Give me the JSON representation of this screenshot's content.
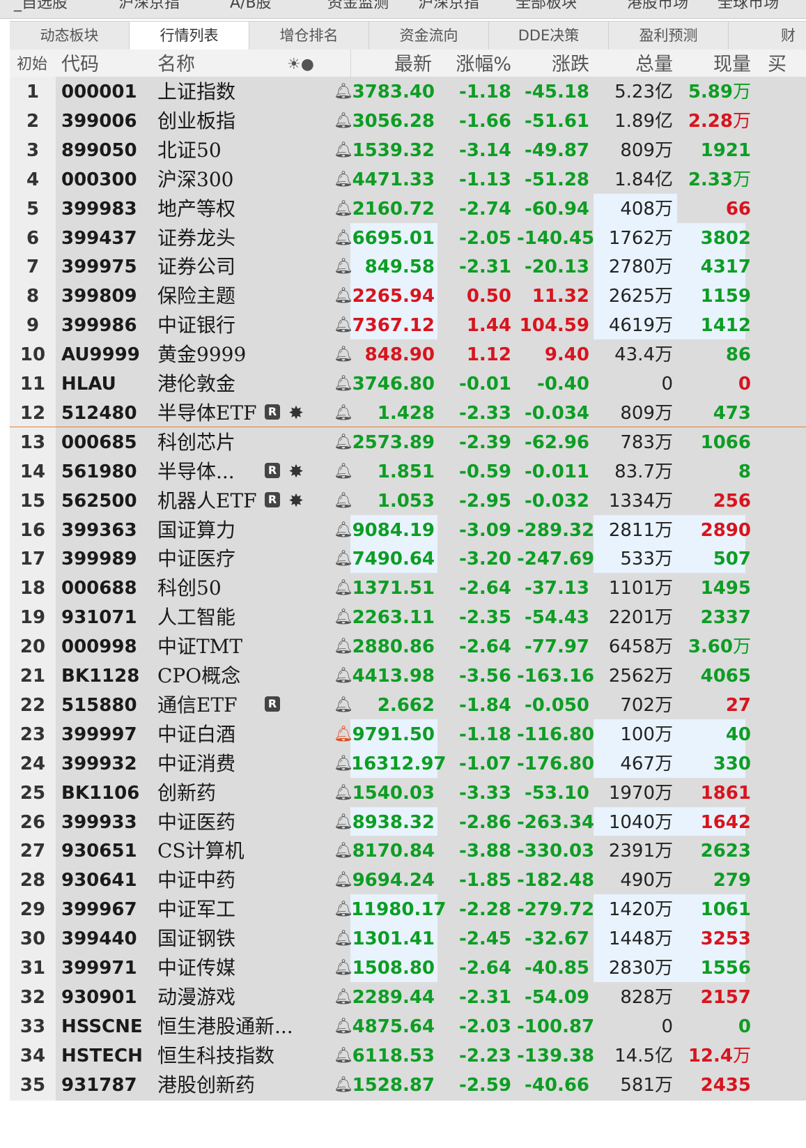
{
  "top_strip": [
    "_自选股",
    "沪深京指",
    "A/B股",
    "资金监测",
    "沪深京指",
    "全部板块",
    "港股市场",
    "全球市场"
  ],
  "tabs": [
    "动态板块",
    "行情列表",
    "增仓排名",
    "资金流向",
    "DDE决策",
    "盈利预测",
    "财"
  ],
  "active_tab": 1,
  "header": {
    "init": "初始",
    "code": "代码",
    "name": "名称",
    "icons": "☀●",
    "last": "最新",
    "pct": "涨幅%",
    "chg": "涨跌",
    "vol": "总量",
    "cur": "现量",
    "more": "买"
  },
  "colors": {
    "up": "#d8141e",
    "down": "#0d9d24",
    "highlight": "#e8f3fe",
    "separator": "#e2803a"
  },
  "rows": [
    {
      "idx": "1",
      "code": "000001",
      "name": "上证指数",
      "r": false,
      "sun": false,
      "bell_red": false,
      "last": "3783.40",
      "pct": "-1.18",
      "chg": "-45.18",
      "vol": "5.23",
      "vol_unit": "亿",
      "cur": "5.89",
      "cur_unit": "万",
      "dir": "down",
      "cur_dir": "down",
      "hl_last": false,
      "hl_right": false
    },
    {
      "idx": "2",
      "code": "399006",
      "name": "创业板指",
      "r": false,
      "sun": false,
      "bell_red": false,
      "last": "3056.28",
      "pct": "-1.66",
      "chg": "-51.61",
      "vol": "1.89",
      "vol_unit": "亿",
      "cur": "2.28",
      "cur_unit": "万",
      "dir": "down",
      "cur_dir": "up",
      "hl_last": false,
      "hl_right": false
    },
    {
      "idx": "3",
      "code": "899050",
      "name": "北证50",
      "r": false,
      "sun": false,
      "bell_red": false,
      "last": "1539.32",
      "pct": "-3.14",
      "chg": "-49.87",
      "vol": "809",
      "vol_unit": "万",
      "cur": "1921",
      "cur_unit": "",
      "dir": "down",
      "cur_dir": "down",
      "hl_last": false,
      "hl_right": false
    },
    {
      "idx": "4",
      "code": "000300",
      "name": "沪深300",
      "r": false,
      "sun": false,
      "bell_red": false,
      "last": "4471.33",
      "pct": "-1.13",
      "chg": "-51.28",
      "vol": "1.84",
      "vol_unit": "亿",
      "cur": "2.33",
      "cur_unit": "万",
      "dir": "down",
      "cur_dir": "down",
      "hl_last": false,
      "hl_right": false
    },
    {
      "idx": "5",
      "code": "399983",
      "name": "地产等权",
      "r": false,
      "sun": false,
      "bell_red": false,
      "last": "2160.72",
      "pct": "-2.74",
      "chg": "-60.94",
      "vol": "408",
      "vol_unit": "万",
      "cur": "66",
      "cur_unit": "",
      "dir": "down",
      "cur_dir": "up",
      "hl_last": false,
      "hl_right": "vol"
    },
    {
      "idx": "6",
      "code": "399437",
      "name": "证券龙头",
      "r": false,
      "sun": false,
      "bell_red": false,
      "last": "6695.01",
      "pct": "-2.05",
      "chg": "-140.45",
      "vol": "1762",
      "vol_unit": "万",
      "cur": "3802",
      "cur_unit": "",
      "dir": "down",
      "cur_dir": "down",
      "hl_last": true,
      "hl_right": true
    },
    {
      "idx": "7",
      "code": "399975",
      "name": "证券公司",
      "r": false,
      "sun": false,
      "bell_red": false,
      "last": "849.58",
      "pct": "-2.31",
      "chg": "-20.13",
      "vol": "2780",
      "vol_unit": "万",
      "cur": "4317",
      "cur_unit": "",
      "dir": "down",
      "cur_dir": "down",
      "hl_last": true,
      "hl_right": true
    },
    {
      "idx": "8",
      "code": "399809",
      "name": "保险主题",
      "r": false,
      "sun": false,
      "bell_red": false,
      "last": "2265.94",
      "pct": "0.50",
      "chg": "11.32",
      "vol": "2625",
      "vol_unit": "万",
      "cur": "1159",
      "cur_unit": "",
      "dir": "up",
      "cur_dir": "down",
      "hl_last": true,
      "hl_right": true
    },
    {
      "idx": "9",
      "code": "399986",
      "name": "中证银行",
      "r": false,
      "sun": false,
      "bell_red": false,
      "last": "7367.12",
      "pct": "1.44",
      "chg": "104.59",
      "vol": "4619",
      "vol_unit": "万",
      "cur": "1412",
      "cur_unit": "",
      "dir": "up",
      "cur_dir": "down",
      "hl_last": true,
      "hl_right": true
    },
    {
      "idx": "10",
      "code": "AU9999",
      "name": "黄金9999",
      "r": false,
      "sun": false,
      "bell_red": false,
      "last": "848.90",
      "pct": "1.12",
      "chg": "9.40",
      "vol": "43.4",
      "vol_unit": "万",
      "cur": "86",
      "cur_unit": "",
      "dir": "up",
      "cur_dir": "down",
      "hl_last": false,
      "hl_right": false
    },
    {
      "idx": "11",
      "code": "HLAU",
      "name": "港伦敦金",
      "r": false,
      "sun": false,
      "bell_red": false,
      "last": "3746.80",
      "pct": "-0.01",
      "chg": "-0.40",
      "vol": "0",
      "vol_unit": "",
      "cur": "0",
      "cur_unit": "",
      "dir": "down",
      "cur_dir": "up",
      "hl_last": false,
      "hl_right": false
    },
    {
      "idx": "12",
      "code": "512480",
      "name": "半导体ETF",
      "r": true,
      "sun": true,
      "bell_red": false,
      "last": "1.428",
      "pct": "-2.33",
      "chg": "-0.034",
      "vol": "809",
      "vol_unit": "万",
      "cur": "473",
      "cur_unit": "",
      "dir": "down",
      "cur_dir": "down",
      "hl_last": false,
      "hl_right": false
    },
    {
      "idx": "13",
      "code": "000685",
      "name": "科创芯片",
      "r": false,
      "sun": false,
      "bell_red": false,
      "last": "2573.89",
      "pct": "-2.39",
      "chg": "-62.96",
      "vol": "783",
      "vol_unit": "万",
      "cur": "1066",
      "cur_unit": "",
      "dir": "down",
      "cur_dir": "down",
      "hl_last": false,
      "hl_right": false
    },
    {
      "idx": "14",
      "code": "561980",
      "name": "半导体...",
      "r": true,
      "sun": true,
      "bell_red": false,
      "last": "1.851",
      "pct": "-0.59",
      "chg": "-0.011",
      "vol": "83.7",
      "vol_unit": "万",
      "cur": "8",
      "cur_unit": "",
      "dir": "down",
      "cur_dir": "down",
      "hl_last": false,
      "hl_right": false
    },
    {
      "idx": "15",
      "code": "562500",
      "name": "机器人ETF",
      "r": true,
      "sun": true,
      "bell_red": false,
      "last": "1.053",
      "pct": "-2.95",
      "chg": "-0.032",
      "vol": "1334",
      "vol_unit": "万",
      "cur": "256",
      "cur_unit": "",
      "dir": "down",
      "cur_dir": "up",
      "hl_last": false,
      "hl_right": false
    },
    {
      "idx": "16",
      "code": "399363",
      "name": "国证算力",
      "r": false,
      "sun": false,
      "bell_red": false,
      "last": "9084.19",
      "pct": "-3.09",
      "chg": "-289.32",
      "vol": "2811",
      "vol_unit": "万",
      "cur": "2890",
      "cur_unit": "",
      "dir": "down",
      "cur_dir": "up",
      "hl_last": true,
      "hl_right": true
    },
    {
      "idx": "17",
      "code": "399989",
      "name": "中证医疗",
      "r": false,
      "sun": false,
      "bell_red": false,
      "last": "7490.64",
      "pct": "-3.20",
      "chg": "-247.69",
      "vol": "533",
      "vol_unit": "万",
      "cur": "507",
      "cur_unit": "",
      "dir": "down",
      "cur_dir": "down",
      "hl_last": true,
      "hl_right": true
    },
    {
      "idx": "18",
      "code": "000688",
      "name": "科创50",
      "r": false,
      "sun": false,
      "bell_red": false,
      "last": "1371.51",
      "pct": "-2.64",
      "chg": "-37.13",
      "vol": "1101",
      "vol_unit": "万",
      "cur": "1495",
      "cur_unit": "",
      "dir": "down",
      "cur_dir": "down",
      "hl_last": false,
      "hl_right": false
    },
    {
      "idx": "19",
      "code": "931071",
      "name": "人工智能",
      "r": false,
      "sun": false,
      "bell_red": false,
      "last": "2263.11",
      "pct": "-2.35",
      "chg": "-54.43",
      "vol": "2201",
      "vol_unit": "万",
      "cur": "2337",
      "cur_unit": "",
      "dir": "down",
      "cur_dir": "down",
      "hl_last": false,
      "hl_right": false
    },
    {
      "idx": "20",
      "code": "000998",
      "name": "中证TMT",
      "r": false,
      "sun": false,
      "bell_red": false,
      "last": "2880.86",
      "pct": "-2.64",
      "chg": "-77.97",
      "vol": "6458",
      "vol_unit": "万",
      "cur": "3.60",
      "cur_unit": "万",
      "dir": "down",
      "cur_dir": "down",
      "hl_last": false,
      "hl_right": false
    },
    {
      "idx": "21",
      "code": "BK1128",
      "name": "CPO概念",
      "r": false,
      "sun": false,
      "bell_red": false,
      "last": "4413.98",
      "pct": "-3.56",
      "chg": "-163.16",
      "vol": "2562",
      "vol_unit": "万",
      "cur": "4065",
      "cur_unit": "",
      "dir": "down",
      "cur_dir": "down",
      "hl_last": false,
      "hl_right": false
    },
    {
      "idx": "22",
      "code": "515880",
      "name": "通信ETF",
      "r": true,
      "sun": false,
      "bell_red": false,
      "last": "2.662",
      "pct": "-1.84",
      "chg": "-0.050",
      "vol": "702",
      "vol_unit": "万",
      "cur": "27",
      "cur_unit": "",
      "dir": "down",
      "cur_dir": "up",
      "hl_last": false,
      "hl_right": false
    },
    {
      "idx": "23",
      "code": "399997",
      "name": "中证白酒",
      "r": false,
      "sun": false,
      "bell_red": true,
      "last": "9791.50",
      "pct": "-1.18",
      "chg": "-116.80",
      "vol": "100",
      "vol_unit": "万",
      "cur": "40",
      "cur_unit": "",
      "dir": "down",
      "cur_dir": "down",
      "hl_last": true,
      "hl_right": true
    },
    {
      "idx": "24",
      "code": "399932",
      "name": "中证消费",
      "r": false,
      "sun": false,
      "bell_red": false,
      "last": "16312.97",
      "pct": "-1.07",
      "chg": "-176.80",
      "vol": "467",
      "vol_unit": "万",
      "cur": "330",
      "cur_unit": "",
      "dir": "down",
      "cur_dir": "down",
      "hl_last": true,
      "hl_right": true
    },
    {
      "idx": "25",
      "code": "BK1106",
      "name": "创新药",
      "r": false,
      "sun": false,
      "bell_red": false,
      "last": "1540.03",
      "pct": "-3.33",
      "chg": "-53.10",
      "vol": "1970",
      "vol_unit": "万",
      "cur": "1861",
      "cur_unit": "",
      "dir": "down",
      "cur_dir": "up",
      "hl_last": false,
      "hl_right": false
    },
    {
      "idx": "26",
      "code": "399933",
      "name": "中证医药",
      "r": false,
      "sun": false,
      "bell_red": false,
      "last": "8938.32",
      "pct": "-2.86",
      "chg": "-263.34",
      "vol": "1040",
      "vol_unit": "万",
      "cur": "1642",
      "cur_unit": "",
      "dir": "down",
      "cur_dir": "up",
      "hl_last": true,
      "hl_right": true
    },
    {
      "idx": "27",
      "code": "930651",
      "name": "CS计算机",
      "r": false,
      "sun": false,
      "bell_red": false,
      "last": "8170.84",
      "pct": "-3.88",
      "chg": "-330.03",
      "vol": "2391",
      "vol_unit": "万",
      "cur": "2623",
      "cur_unit": "",
      "dir": "down",
      "cur_dir": "down",
      "hl_last": false,
      "hl_right": false
    },
    {
      "idx": "28",
      "code": "930641",
      "name": "中证中药",
      "r": false,
      "sun": false,
      "bell_red": false,
      "last": "9694.24",
      "pct": "-1.85",
      "chg": "-182.48",
      "vol": "490",
      "vol_unit": "万",
      "cur": "279",
      "cur_unit": "",
      "dir": "down",
      "cur_dir": "down",
      "hl_last": false,
      "hl_right": false
    },
    {
      "idx": "29",
      "code": "399967",
      "name": "中证军工",
      "r": false,
      "sun": false,
      "bell_red": false,
      "last": "11980.17",
      "pct": "-2.28",
      "chg": "-279.72",
      "vol": "1420",
      "vol_unit": "万",
      "cur": "1061",
      "cur_unit": "",
      "dir": "down",
      "cur_dir": "down",
      "hl_last": true,
      "hl_right": true
    },
    {
      "idx": "30",
      "code": "399440",
      "name": "国证钢铁",
      "r": false,
      "sun": false,
      "bell_red": false,
      "last": "1301.41",
      "pct": "-2.45",
      "chg": "-32.67",
      "vol": "1448",
      "vol_unit": "万",
      "cur": "3253",
      "cur_unit": "",
      "dir": "down",
      "cur_dir": "up",
      "hl_last": true,
      "hl_right": true
    },
    {
      "idx": "31",
      "code": "399971",
      "name": "中证传媒",
      "r": false,
      "sun": false,
      "bell_red": false,
      "last": "1508.80",
      "pct": "-2.64",
      "chg": "-40.85",
      "vol": "2830",
      "vol_unit": "万",
      "cur": "1556",
      "cur_unit": "",
      "dir": "down",
      "cur_dir": "down",
      "hl_last": true,
      "hl_right": true
    },
    {
      "idx": "32",
      "code": "930901",
      "name": "动漫游戏",
      "r": false,
      "sun": false,
      "bell_red": false,
      "last": "2289.44",
      "pct": "-2.31",
      "chg": "-54.09",
      "vol": "828",
      "vol_unit": "万",
      "cur": "2157",
      "cur_unit": "",
      "dir": "down",
      "cur_dir": "up",
      "hl_last": false,
      "hl_right": false
    },
    {
      "idx": "33",
      "code": "HSSCNE",
      "name": "恒生港股通新...",
      "r": false,
      "sun": false,
      "bell_red": false,
      "last": "4875.64",
      "pct": "-2.03",
      "chg": "-100.87",
      "vol": "0",
      "vol_unit": "",
      "cur": "0",
      "cur_unit": "",
      "dir": "down",
      "cur_dir": "down",
      "hl_last": false,
      "hl_right": false
    },
    {
      "idx": "34",
      "code": "HSTECH",
      "name": "恒生科技指数",
      "r": false,
      "sun": false,
      "bell_red": false,
      "last": "6118.53",
      "pct": "-2.23",
      "chg": "-139.38",
      "vol": "14.5",
      "vol_unit": "亿",
      "cur": "12.4",
      "cur_unit": "万",
      "dir": "down",
      "cur_dir": "up",
      "hl_last": false,
      "hl_right": false
    },
    {
      "idx": "35",
      "code": "931787",
      "name": "港股创新药",
      "r": false,
      "sun": false,
      "bell_red": false,
      "last": "1528.87",
      "pct": "-2.59",
      "chg": "-40.66",
      "vol": "581",
      "vol_unit": "万",
      "cur": "2435",
      "cur_unit": "",
      "dir": "down",
      "cur_dir": "up",
      "hl_last": false,
      "hl_right": false
    }
  ]
}
